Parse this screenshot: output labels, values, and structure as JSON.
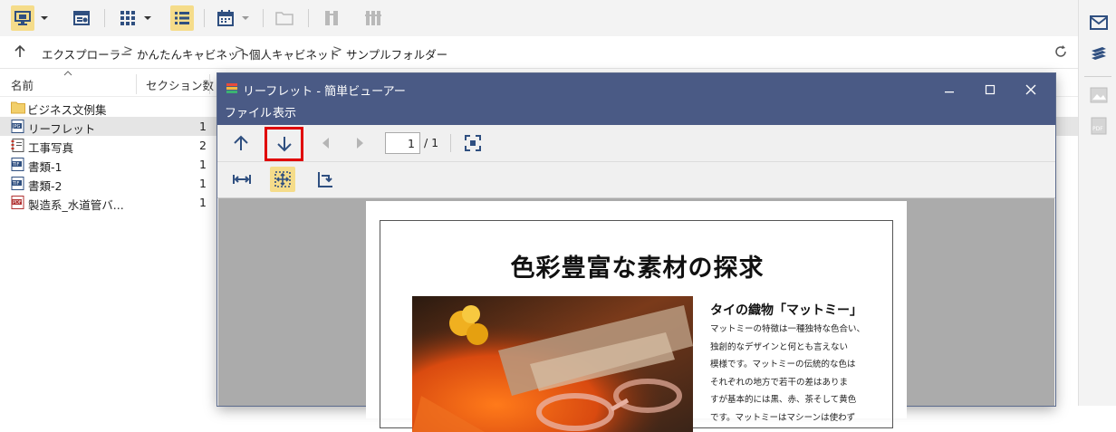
{
  "breadcrumb": {
    "items": [
      "エクスプローラー",
      "かんたんキャビネット",
      "個人キャビネット",
      "サンプルフォルダー"
    ],
    "separator": ">"
  },
  "filelist": {
    "columns": [
      "名前",
      "セクション数"
    ],
    "rows": [
      {
        "name": "ビジネス文例集",
        "count": "",
        "icon": "folder-icon"
      },
      {
        "name": "リーフレット",
        "count": "1",
        "icon": "jpeg-file-icon"
      },
      {
        "name": "工事写真",
        "count": "2",
        "icon": "photo-album-icon"
      },
      {
        "name": "書類-1",
        "count": "1",
        "icon": "tiff-file-icon"
      },
      {
        "name": "書類-2",
        "count": "1",
        "icon": "tiff-file-icon"
      },
      {
        "name": "製造系_水道管バ...",
        "count": "1",
        "icon": "pdf-file-icon"
      }
    ]
  },
  "viewer": {
    "title": "リーフレット - 簡単ビューアー",
    "menu": [
      "ファイル",
      "表示"
    ],
    "page_current": "1",
    "page_total": "/ 1",
    "document": {
      "heading": "色彩豊富な素材の探求",
      "subheading": "タイの織物「マットミー」",
      "body_lines": [
        "マットミーの特徴は一種独特な色合い、",
        "独創的なデザインと何とも言えない",
        "模様です。マットミーの伝統的な色は",
        "それぞれの地方で若干の差はありま",
        "すが基本的には黒、赤、茶そして黄色",
        "です。マットミーはマシーンは使わず"
      ]
    }
  },
  "colors": {
    "titlebar": "#4a5a85",
    "highlight": "#f5dc8a",
    "annotation_box": "#e00000",
    "toolbar_icon": "#2f4f80"
  }
}
